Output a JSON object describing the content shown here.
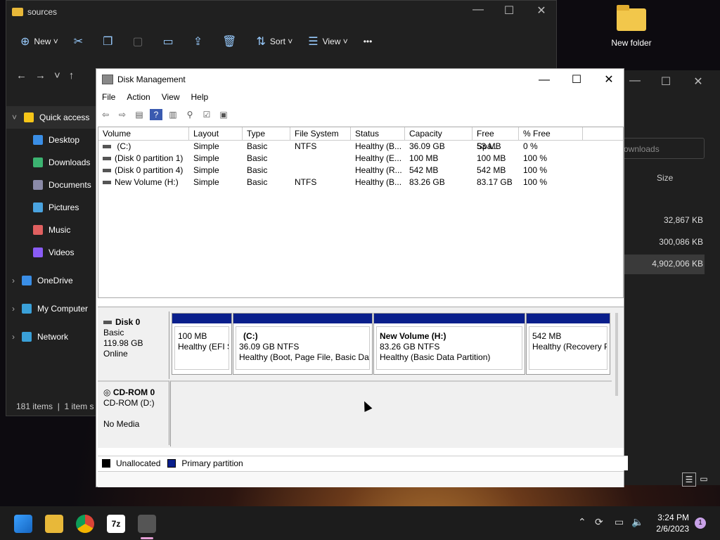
{
  "desktop": {
    "folder_label": "New folder"
  },
  "explorer": {
    "title": "sources",
    "toolbar": {
      "new": "New",
      "sort": "Sort",
      "view": "View",
      "more": "•••"
    },
    "sidebar": [
      {
        "label": "Quick access",
        "color": "#f5c518"
      },
      {
        "label": "Desktop",
        "color": "#3a8ee6"
      },
      {
        "label": "Downloads",
        "color": "#3cb371"
      },
      {
        "label": "Documents",
        "color": "#8a8aa8"
      },
      {
        "label": "Pictures",
        "color": "#4aa3df"
      },
      {
        "label": "Music",
        "color": "#e06060"
      },
      {
        "label": "Videos",
        "color": "#8a5cf6"
      },
      {
        "label": "OneDrive",
        "color": "#3a8ee6"
      },
      {
        "label": "My Computer",
        "color": "#3aa0d8"
      },
      {
        "label": "Network",
        "color": "#3aa0d8"
      }
    ],
    "status_items": "181 items",
    "status_selected": "1 item s"
  },
  "explorer2": {
    "search_placeholder": "ownloads",
    "size_header": "Size",
    "sizes": [
      "32,867 KB",
      "300,086 KB",
      "4,902,006 KB"
    ]
  },
  "diskmgmt": {
    "title": "Disk Management",
    "menu": [
      "File",
      "Action",
      "View",
      "Help"
    ],
    "columns": [
      "Volume",
      "Layout",
      "Type",
      "File System",
      "Status",
      "Capacity",
      "Free Spa...",
      "% Free"
    ],
    "rows": [
      [
        "  (C:)",
        "Simple",
        "Basic",
        "NTFS",
        "Healthy (B...",
        "36.09 GB",
        "53 MB",
        "0 %"
      ],
      [
        "(Disk 0 partition 1)",
        "Simple",
        "Basic",
        "",
        "Healthy (E...",
        "100 MB",
        "100 MB",
        "100 %"
      ],
      [
        "(Disk 0 partition 4)",
        "Simple",
        "Basic",
        "",
        "Healthy (R...",
        "542 MB",
        "542 MB",
        "100 %"
      ],
      [
        "New Volume (H:)",
        "Simple",
        "Basic",
        "NTFS",
        "Healthy (B...",
        "83.26 GB",
        "83.17 GB",
        "100 %"
      ]
    ],
    "disk0": {
      "name": "Disk 0",
      "type": "Basic",
      "size": "119.98 GB",
      "state": "Online"
    },
    "partitions": [
      {
        "title": "",
        "size": "100 MB",
        "status": "Healthy (EFI S"
      },
      {
        "title": "(C:)",
        "size": "36.09 GB NTFS",
        "status": "Healthy (Boot, Page File, Basic Data"
      },
      {
        "title": "New Volume  (H:)",
        "size": "83.26 GB NTFS",
        "status": "Healthy (Basic Data Partition)"
      },
      {
        "title": "",
        "size": "542 MB",
        "status": "Healthy (Recovery P"
      }
    ],
    "cdrom": {
      "name": "CD-ROM 0",
      "drive": "CD-ROM (D:)",
      "media": "No Media"
    },
    "legend": {
      "unallocated": "Unallocated",
      "primary": "Primary partition",
      "unallocated_color": "#000000",
      "primary_color": "#0a1f8c"
    }
  },
  "taskbar": {
    "time": "3:24 PM",
    "date": "2/6/2023",
    "notifications": "1",
    "sevenzip": "7z"
  }
}
